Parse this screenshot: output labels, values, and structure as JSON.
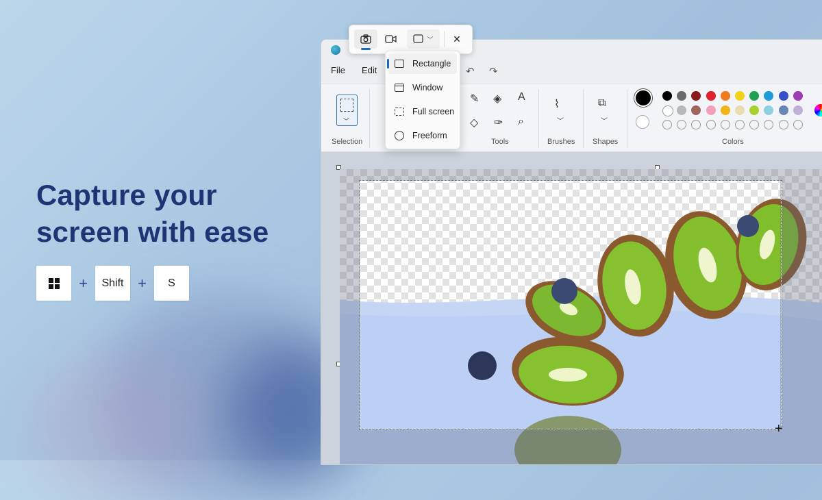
{
  "promo": {
    "headline_line1": "Capture your",
    "headline_line2": "screen with ease",
    "plus1": "+",
    "plus2": "+",
    "key_shift": "Shift",
    "key_s": "S"
  },
  "paint": {
    "menu": [
      "File",
      "Edit"
    ],
    "groups": {
      "selection": "Selection",
      "tools": "Tools",
      "brushes": "Brushes",
      "shapes": "Shapes",
      "colors": "Colors"
    },
    "primary_color": "#000000",
    "palette_row1": [
      "#000000",
      "#6b6b6b",
      "#8b1a1a",
      "#e0202a",
      "#f07a1e",
      "#f2d21a",
      "#20a050",
      "#1d9ad8",
      "#3650c9",
      "#9a3eb0"
    ],
    "palette_row2": [
      "#ffffff",
      "#b8b8b8",
      "#a0645a",
      "#f0a0b8",
      "#f0b41a",
      "#e8ddb0",
      "#a8d030",
      "#8ed0e0",
      "#6a86b8",
      "#c0b0d8"
    ]
  },
  "snip_toolbar": {
    "icons": [
      "camera-icon",
      "video-icon",
      "rectangle-mode-icon",
      "chevron-down-icon",
      "close-icon"
    ],
    "close_glyph": "✕"
  },
  "snip_modes": [
    {
      "label": "Rectangle",
      "selected": true
    },
    {
      "label": "Window",
      "selected": false
    },
    {
      "label": "Full screen",
      "selected": false
    },
    {
      "label": "Freeform",
      "selected": false
    }
  ],
  "colors": {
    "accent": "#1a6ac0",
    "headline": "#1d3575"
  }
}
